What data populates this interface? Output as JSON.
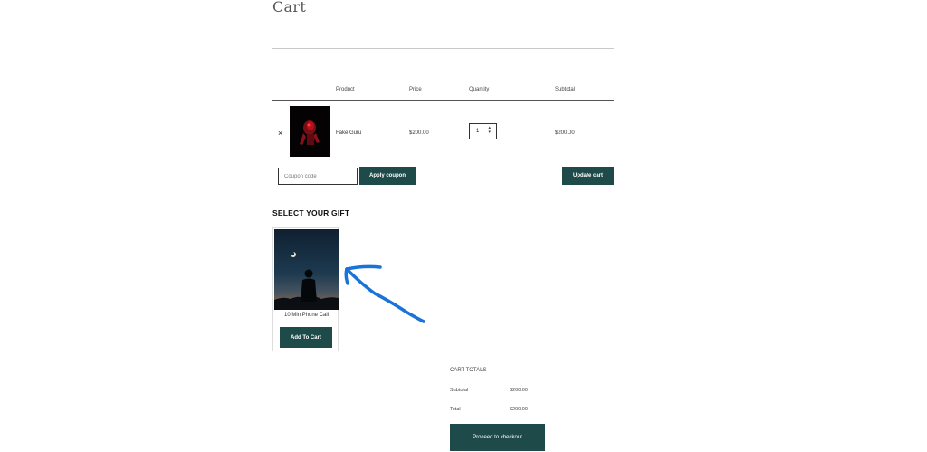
{
  "page": {
    "title": "Cart"
  },
  "table": {
    "headers": {
      "product": "Product",
      "price": "Price",
      "quantity": "Quantity",
      "subtotal": "Subtotal"
    },
    "rows": [
      {
        "remove": "×",
        "name": "Fake Guru",
        "price": "$200.00",
        "quantity": "1",
        "subtotal": "$200.00"
      }
    ]
  },
  "actions": {
    "coupon_placeholder": "Coupon code",
    "apply_coupon": "Apply coupon",
    "update_cart": "Update cart"
  },
  "gift": {
    "heading": "SELECT YOUR GIFT",
    "item": {
      "name": "10 Min Phone Call",
      "button": "Add To Cart"
    }
  },
  "totals": {
    "title": "CART TOTALS",
    "subtotal_label": "Subtotal",
    "subtotal_value": "$200.00",
    "total_label": "Total",
    "total_value": "$200.00",
    "checkout": "Proceed to checkout"
  },
  "colors": {
    "button": "#1f4a4a",
    "annotation_arrow": "#1a73d9"
  },
  "icons": {
    "remove": "close-icon",
    "quantity": "spinner-arrows-icon",
    "annotation": "hand-drawn-arrow-icon"
  }
}
